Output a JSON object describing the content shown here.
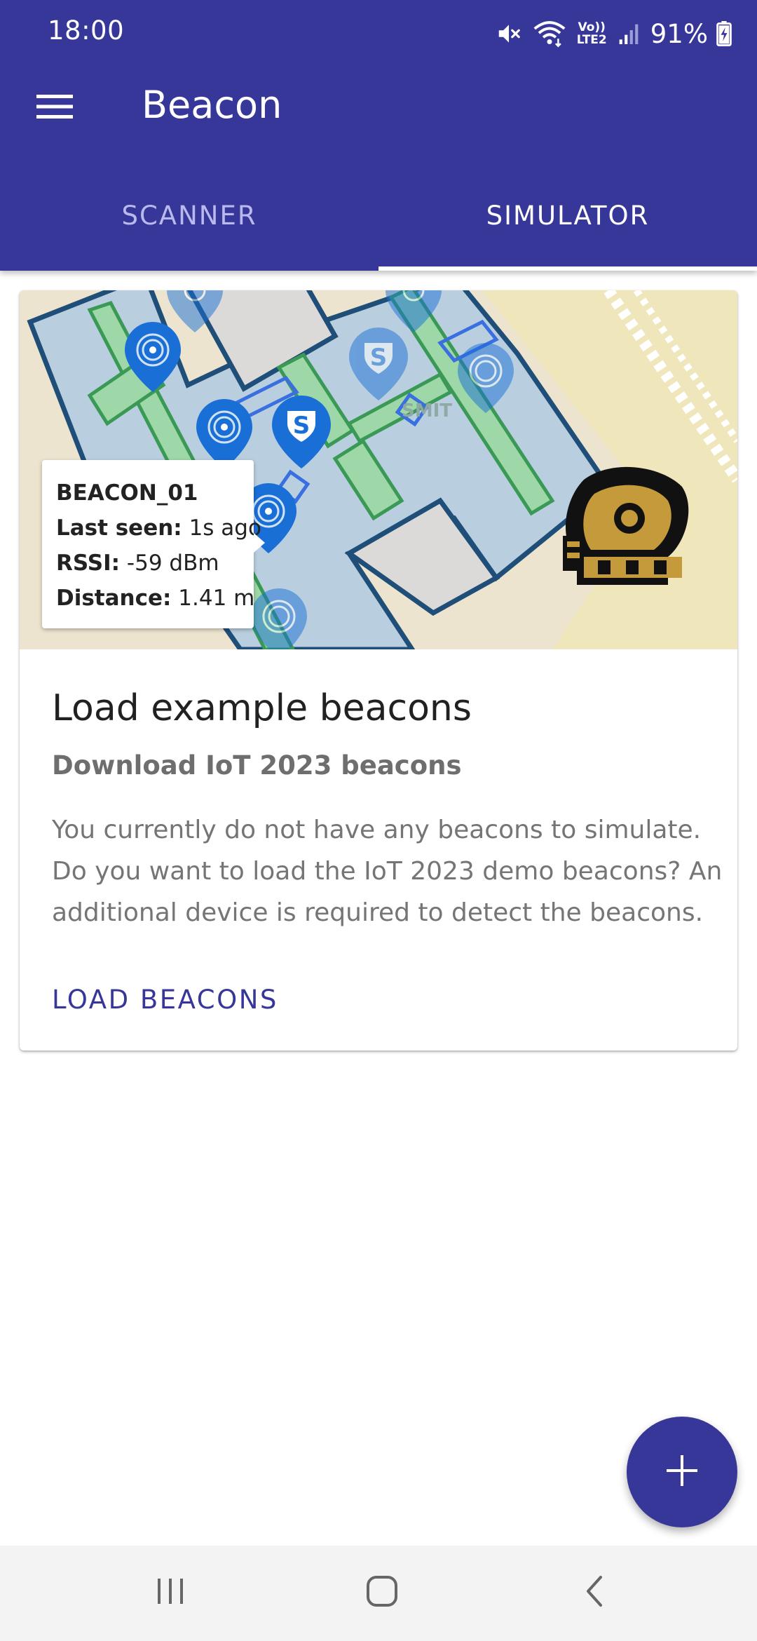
{
  "status_bar": {
    "time": "18:00",
    "battery": "91%",
    "icons": [
      "mute-icon",
      "wifi-icon",
      "volte-icon",
      "signal-icon",
      "battery-charging-icon"
    ],
    "volte_line1": "Vo))",
    "volte_line2": "LTE2"
  },
  "toolbar": {
    "title": "Beacon",
    "menu_icon": "hamburger-menu-icon"
  },
  "tabs": [
    {
      "label": "SCANNER",
      "selected": false
    },
    {
      "label": "SIMULATOR",
      "selected": true
    }
  ],
  "card": {
    "map": {
      "tooltip": {
        "name": "BEACON_01",
        "last_seen_label": "Last seen:",
        "last_seen_value": "1s ago",
        "rssi_label": "RSSI:",
        "rssi_value": "-59 dBm",
        "distance_label": "Distance:",
        "distance_value": "1.41 m"
      },
      "map_label": "SMIT",
      "marker_letter": "S"
    },
    "title": "Load example beacons",
    "subtitle": "Download IoT 2023 beacons",
    "text": "You currently do not have any beacons to simulate. Do you want to load the IoT 2023 demo beacons? An additional device is required to detect the beacons.",
    "action": "LOAD BEACONS"
  },
  "fab": {
    "icon": "plus-icon"
  },
  "nav_bar": {
    "icons": [
      "recents-icon",
      "home-icon",
      "back-icon"
    ]
  },
  "colors": {
    "primary": "#37379a",
    "tab_inactive": "#b9b9ee",
    "beacon_marker": "#1a6fd6",
    "room_fill": "#b9cfe0",
    "corridor_fill": "#9ed7a8",
    "logo_gold": "#c49a3a"
  }
}
